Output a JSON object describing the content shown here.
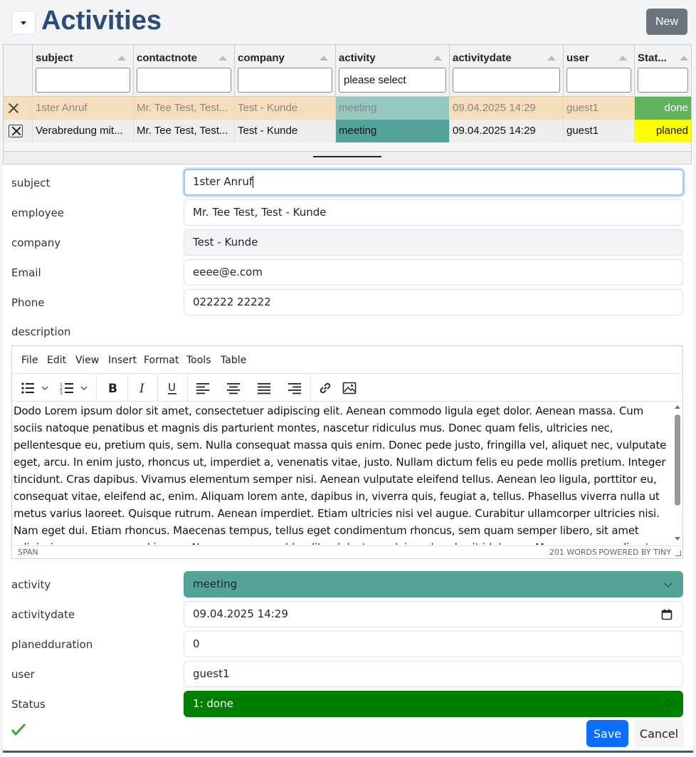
{
  "header": {
    "title": "Activities",
    "new_label": "New"
  },
  "grid": {
    "columns": [
      {
        "label": "subject",
        "filter": ""
      },
      {
        "label": "contactnote",
        "filter": ""
      },
      {
        "label": "company",
        "filter": ""
      },
      {
        "label": "activity",
        "filter": "please select"
      },
      {
        "label": "activitydate",
        "filter": ""
      },
      {
        "label": "user",
        "filter": ""
      },
      {
        "label": "Stat...",
        "filter": ""
      }
    ],
    "rows": [
      {
        "subject": "1ster Anruf",
        "contactnote": "Mr. Tee Test, Test...",
        "company": "Test - Kunde",
        "activity": "meeting",
        "activitydate": "09.04.2025 14:29",
        "user": "guest1",
        "status": "done"
      },
      {
        "subject": "Verabredung mit...",
        "contactnote": "Mr. Tee Test, Test...",
        "company": "Test - Kunde",
        "activity": "meeting",
        "activitydate": "09.04.2025 14:29",
        "user": "guest1",
        "status": "planed"
      }
    ]
  },
  "form": {
    "subject_label": "subject",
    "subject_value": "1ster Anruf",
    "employee_label": "employee",
    "employee_value": "Mr. Tee Test, Test - Kunde",
    "company_label": "company",
    "company_value": "Test - Kunde",
    "email_label": "Email",
    "email_value": "eeee@e.com",
    "phone_label": "Phone",
    "phone_value": "022222 22222",
    "description_label": "description",
    "activity_label": "activity",
    "activity_value": "meeting",
    "activitydate_label": "activitydate",
    "activitydate_value": "09.04.2025 14:29",
    "planedduration_label": "planedduration",
    "planedduration_value": "0",
    "user_label": "user",
    "user_value": "guest1",
    "status_label": "Status",
    "status_value": "1: done",
    "save_label": "Save",
    "cancel_label": "Cancel"
  },
  "editor": {
    "menu": [
      "File",
      "Edit",
      "View",
      "Insert",
      "Format",
      "Tools",
      "Table"
    ],
    "toolbar_icons": [
      "bullet-list-icon",
      "numbered-list-icon",
      "bold-icon",
      "italic-icon",
      "underline-icon",
      "align-left-icon",
      "align-center-icon",
      "align-justify-icon",
      "align-right-icon",
      "link-icon",
      "image-icon"
    ],
    "content": "Dodo Lorem ipsum dolor sit amet, consectetuer adipiscing elit. Aenean commodo ligula eget dolor. Aenean massa. Cum sociis natoque penatibus et magnis dis parturient montes, nascetur ridiculus mus. Donec quam felis, ultricies nec, pellentesque eu, pretium quis, sem. Nulla consequat massa quis enim. Donec pede justo, fringilla vel, aliquet nec, vulputate eget, arcu. In enim justo, rhoncus ut, imperdiet a, venenatis vitae, justo. Nullam dictum felis eu pede mollis pretium. Integer tincidunt. Cras dapibus. Vivamus elementum semper nisi. Aenean vulputate eleifend tellus. Aenean leo ligula, porttitor eu, consequat vitae, eleifend ac, enim. Aliquam lorem ante, dapibus in, viverra quis, feugiat a, tellus. Phasellus viverra nulla ut metus varius laoreet. Quisque rutrum. Aenean imperdiet. Etiam ultricies nisi vel augue. Curabitur ullamcorper ultricies nisi. Nam eget dui. Etiam rhoncus. Maecenas tempus, tellus eget condimentum rhoncus, sem quam semper libero, sit amet adipiscing sem neque sed ipsum. Nam quam nunc, blandit vel, luctus pulvinar, hendrerit id, lorem. Maecenas nec odio et ante tincidunt tempus. Donec vitae sapien ut libero venenatis",
    "status_path": "SPAN",
    "word_count": "201 WORDS",
    "powered_by": "POWERED BY TINY"
  },
  "colors": {
    "title": "#2c4a7a",
    "row_done_bg": "#f5deb9",
    "activity_teal": "#54a399",
    "status_done": "#5fb35f",
    "status_planed": "#ffff00",
    "status_select": "#008000",
    "primary": "#0d6efd"
  }
}
